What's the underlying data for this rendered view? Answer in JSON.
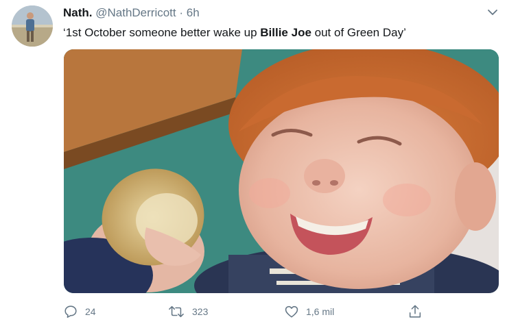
{
  "tweet": {
    "author": {
      "display_name": "Nath.",
      "handle": "@NathDerricott",
      "avatar_icon": "avatar-photo"
    },
    "separator": "·",
    "time": "6h",
    "text": {
      "before": "‘1st October someone better wake up ",
      "bold": "Billie Joe",
      "after": " out of Green Day’"
    },
    "menu_icon": "chevron-down-icon",
    "media": {
      "kind": "photo",
      "icon": "laughing-child-with-bread-photo"
    }
  },
  "actions": {
    "reply": {
      "icon": "reply-icon",
      "count": "24"
    },
    "retweet": {
      "icon": "retweet-icon",
      "count": "323"
    },
    "like": {
      "icon": "heart-icon",
      "count": "1,6 mil"
    },
    "share": {
      "icon": "share-icon"
    }
  },
  "colors": {
    "text": "#14171a",
    "secondary": "#657786",
    "background": "#ffffff"
  }
}
